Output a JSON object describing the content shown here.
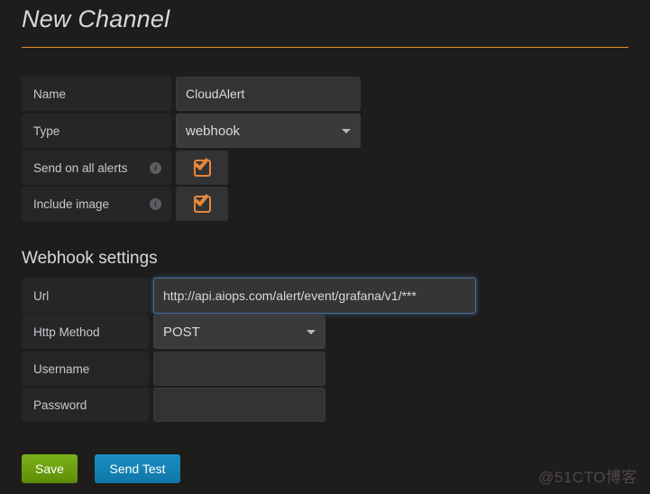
{
  "page": {
    "title": "New Channel",
    "watermark": "@51CTO博客"
  },
  "channel_form": {
    "rows": [
      {
        "label": "Name",
        "value": "CloudAlert",
        "type": "text"
      },
      {
        "label": "Type",
        "value": "webhook",
        "type": "select"
      },
      {
        "label": "Send on all alerts",
        "value": "checked",
        "type": "checkbox",
        "info": "i"
      },
      {
        "label": "Include image",
        "value": "checked",
        "type": "checkbox",
        "info": "i"
      }
    ]
  },
  "webhook_settings": {
    "heading": "Webhook settings",
    "rows": [
      {
        "label": "Url",
        "value": "http://api.aiops.com/alert/event/grafana/v1/***",
        "type": "text"
      },
      {
        "label": "Http Method",
        "value": "POST",
        "type": "select"
      },
      {
        "label": "Username",
        "value": "",
        "type": "text"
      },
      {
        "label": "Password",
        "value": "",
        "type": "password"
      }
    ]
  },
  "actions": {
    "save_label": "Save",
    "send_test_label": "Send Test"
  },
  "colors": {
    "accent_orange": "#e0912a",
    "checkbox_orange": "#e8873a",
    "save_green": "#5d8c07",
    "test_blue": "#0f76a8",
    "background": "#1f1d1c",
    "field_bg": "#333333",
    "label_bg": "#262626",
    "focus_blue": "#4a6f93"
  }
}
